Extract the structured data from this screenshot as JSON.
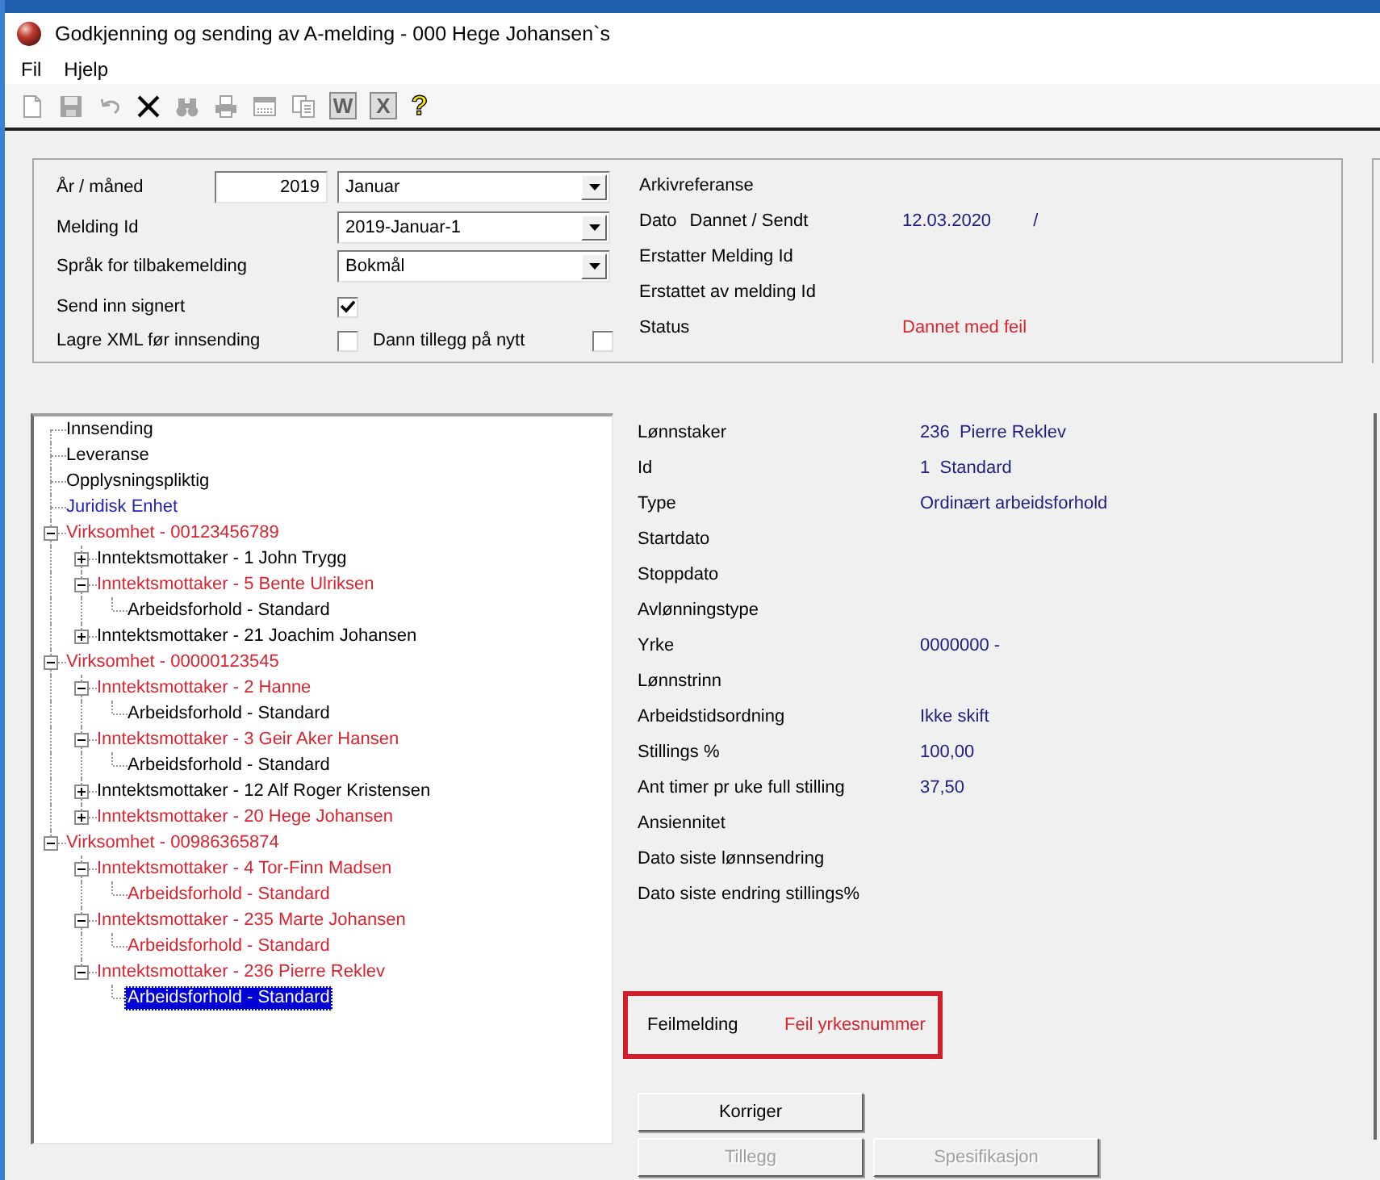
{
  "window": {
    "title": "Godkjenning og sending av A-melding - 000 Hege Johansen`s"
  },
  "menu": [
    "Fil",
    "Hjelp"
  ],
  "toolbar": [
    {
      "kind": "icon",
      "disabled": true
    },
    {
      "kind": "icon",
      "disabled": true
    },
    {
      "kind": "icon",
      "disabled": true
    },
    {
      "kind": "icon",
      "disabled": false
    },
    {
      "kind": "icon",
      "disabled": true
    },
    {
      "kind": "icon",
      "disabled": true
    },
    {
      "kind": "icon",
      "disabled": true
    },
    {
      "kind": "icon",
      "disabled": true
    },
    {
      "kind": "tile",
      "disabled": true,
      "glyph": "W"
    },
    {
      "kind": "tile",
      "disabled": true,
      "glyph": "X"
    },
    {
      "kind": "glyph",
      "disabled": false,
      "glyph": "?"
    }
  ],
  "form": {
    "fields": [
      {
        "label": "År / måned",
        "input": "2019",
        "select": "Januar"
      },
      {
        "label": "Melding Id",
        "select": "2019-Januar-1"
      },
      {
        "label": "Språk for tilbakemelding",
        "select": "Bokmål"
      }
    ],
    "checkboxes": [
      {
        "label": "Send inn signert",
        "checked": true
      },
      {
        "label": "Lagre XML før innsending",
        "checked": false
      },
      {
        "label": "Dann tillegg på nytt",
        "checked": false
      }
    ]
  },
  "archive": [
    {
      "label": "Arkivreferanse"
    },
    {
      "label": "Dato",
      "sublabel": "Dannet / Sendt",
      "kind": "plain",
      "value": "12.03.2020",
      "value_2": "/"
    },
    {
      "label": "Erstatter Melding Id"
    },
    {
      "label": "Erstattet av melding Id"
    },
    {
      "label": "Status",
      "kind": "error",
      "value": "Dannet med feil"
    }
  ],
  "tree": [
    {
      "kind": "leaf",
      "label": "Innsending",
      "color": "#000000",
      "selected": false
    },
    {
      "kind": "leaf",
      "label": "Leveranse",
      "color": "#000000",
      "selected": false
    },
    {
      "kind": "leaf",
      "label": "Opplysningspliktig",
      "color": "#000000",
      "selected": false
    },
    {
      "kind": "leaf",
      "label": "Juridisk Enhet",
      "color": "#2424b4",
      "selected": false
    },
    {
      "kind": "branch",
      "label": "Virksomhet - 00123456789",
      "color": "#d9232e",
      "selected": false,
      "expanded": true,
      "children": [
        {
          "kind": "branch",
          "label": "Inntektsmottaker - 1 John Trygg",
          "color": "#000000",
          "selected": false,
          "expanded": false
        },
        {
          "kind": "branch",
          "label": "Inntektsmottaker - 5 Bente Ulriksen",
          "color": "#d9232e",
          "selected": false,
          "expanded": true,
          "children": [
            {
              "kind": "leaf",
              "label": "Arbeidsforhold - Standard",
              "color": "#000000",
              "selected": false
            }
          ]
        },
        {
          "kind": "branch",
          "label": "Inntektsmottaker - 21 Joachim Johansen",
          "color": "#000000",
          "selected": false,
          "expanded": false
        }
      ]
    },
    {
      "kind": "branch",
      "label": "Virksomhet - 00000123545",
      "color": "#d9232e",
      "selected": false,
      "expanded": true,
      "children": [
        {
          "kind": "branch",
          "label": "Inntektsmottaker - 2 Hanne",
          "color": "#d9232e",
          "selected": false,
          "expanded": true,
          "children": [
            {
              "kind": "leaf",
              "label": "Arbeidsforhold - Standard",
              "color": "#000000",
              "selected": false
            }
          ]
        },
        {
          "kind": "branch",
          "label": "Inntektsmottaker - 3 Geir Aker Hansen",
          "color": "#d9232e",
          "selected": false,
          "expanded": true,
          "children": [
            {
              "kind": "leaf",
              "label": "Arbeidsforhold - Standard",
              "color": "#000000",
              "selected": false
            }
          ]
        },
        {
          "kind": "branch",
          "label": "Inntektsmottaker - 12 Alf Roger Kristensen",
          "color": "#000000",
          "selected": false,
          "expanded": false
        },
        {
          "kind": "branch",
          "label": "Inntektsmottaker - 20 Hege Johansen",
          "color": "#d9232e",
          "selected": false,
          "expanded": false
        }
      ]
    },
    {
      "kind": "branch",
      "label": "Virksomhet - 00986365874",
      "color": "#d9232e",
      "selected": false,
      "expanded": true,
      "children": [
        {
          "kind": "branch",
          "label": "Inntektsmottaker - 4 Tor-Finn Madsen",
          "color": "#d9232e",
          "selected": false,
          "expanded": true,
          "children": [
            {
              "kind": "leaf",
              "label": "Arbeidsforhold - Standard",
              "color": "#d9232e",
              "selected": false
            }
          ]
        },
        {
          "kind": "branch",
          "label": "Inntektsmottaker - 235 Marte Johansen",
          "color": "#d9232e",
          "selected": false,
          "expanded": true,
          "children": [
            {
              "kind": "leaf",
              "label": "Arbeidsforhold - Standard",
              "color": "#d9232e",
              "selected": false
            }
          ]
        },
        {
          "kind": "branch",
          "label": "Inntektsmottaker - 236 Pierre Reklev",
          "color": "#d9232e",
          "selected": false,
          "expanded": true,
          "children": [
            {
              "kind": "leaf",
              "label": "Arbeidsforhold - Standard",
              "selected": true
            }
          ]
        }
      ]
    }
  ],
  "details": [
    {
      "label": "Lønnstaker",
      "value": "236  Pierre Reklev"
    },
    {
      "label": "Id",
      "value": "1  Standard"
    },
    {
      "label": "Type",
      "value": "Ordinært arbeidsforhold"
    },
    {
      "label": "Startdato"
    },
    {
      "label": "Stoppdato"
    },
    {
      "label": "Avlønningstype"
    },
    {
      "label": "Yrke",
      "value": "0000000 -"
    },
    {
      "label": "Lønnstrinn"
    },
    {
      "label": "Arbeidstidsordning",
      "value": "Ikke skift"
    },
    {
      "label": "Stillings %",
      "value": "100,00"
    },
    {
      "label": "Ant timer pr uke full stilling",
      "value": "37,50"
    },
    {
      "label": "Ansiennitet"
    },
    {
      "label": "Dato siste lønnsendring"
    },
    {
      "label": "Dato siste endring stillings%"
    }
  ],
  "error": {
    "label": "Feilmelding",
    "value": "Feil yrkesnummer"
  },
  "buttons": [
    {
      "label": "Korriger",
      "disabled": false
    },
    {
      "label": "Tillegg",
      "disabled": true
    },
    {
      "label": "Spesifikasjon",
      "disabled": true
    }
  ]
}
